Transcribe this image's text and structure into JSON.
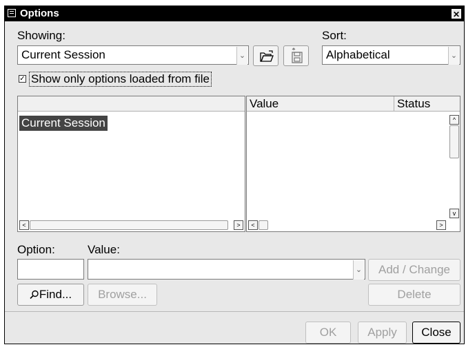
{
  "window": {
    "title": "Options"
  },
  "showing": {
    "label": "Showing:",
    "value": "Current Session"
  },
  "sort": {
    "label": "Sort:",
    "value": "Alphabetical"
  },
  "show_only_checkbox": {
    "label": "Show only options loaded from file",
    "checked": true
  },
  "tree": {
    "items": [
      "Current Session"
    ]
  },
  "table": {
    "columns": [
      "Value",
      "Status"
    ]
  },
  "option_field": {
    "label": "Option:",
    "value": ""
  },
  "value_field": {
    "label": "Value:",
    "value": ""
  },
  "buttons": {
    "add_change": "Add / Change",
    "find": "Find...",
    "browse": "Browse...",
    "delete": "Delete",
    "ok": "OK",
    "apply": "Apply",
    "close": "Close"
  },
  "icons": {
    "open": "open-folder-icon",
    "save": "save-disk-icon",
    "find": "magnifier-icon"
  }
}
